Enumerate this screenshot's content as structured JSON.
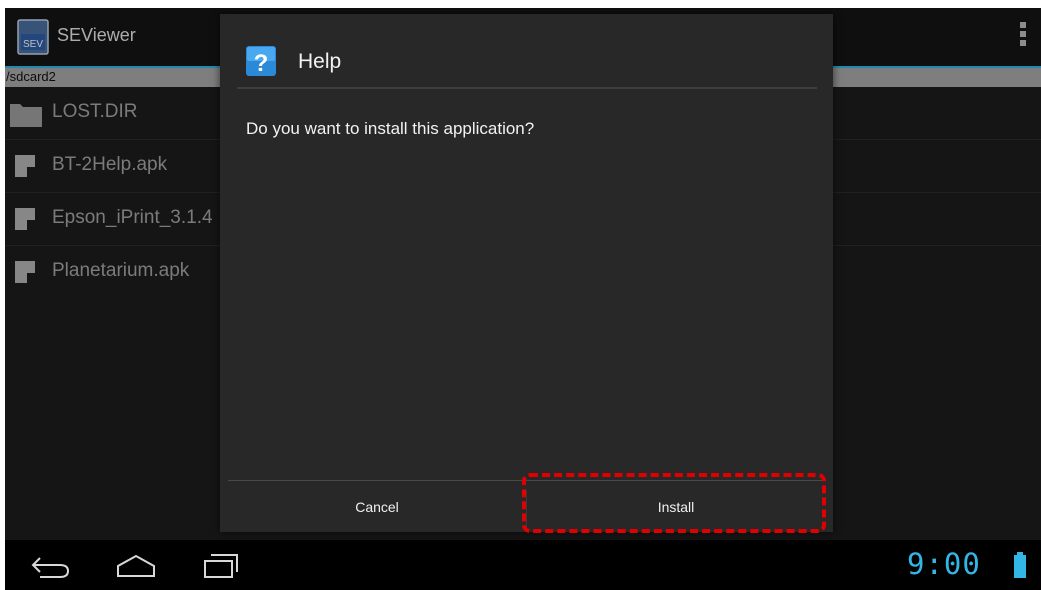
{
  "app": {
    "title": "SEViewer",
    "icon_text": "SEV",
    "path": "/sdcard2",
    "files": [
      {
        "name": "LOST.DIR",
        "kind": "folder"
      },
      {
        "name": "BT-2Help.apk",
        "kind": "file"
      },
      {
        "name": "Epson_iPrint_3.1.4",
        "kind": "file"
      },
      {
        "name": "Planetarium.apk",
        "kind": "file"
      }
    ]
  },
  "dialog": {
    "title": "Help",
    "icon": "question-icon",
    "message": "Do you want to install this application?",
    "cancel_label": "Cancel",
    "install_label": "Install",
    "highlight_color": "#e00000"
  },
  "statusbar": {
    "time": "9:00",
    "accent": "#33b5e5"
  }
}
